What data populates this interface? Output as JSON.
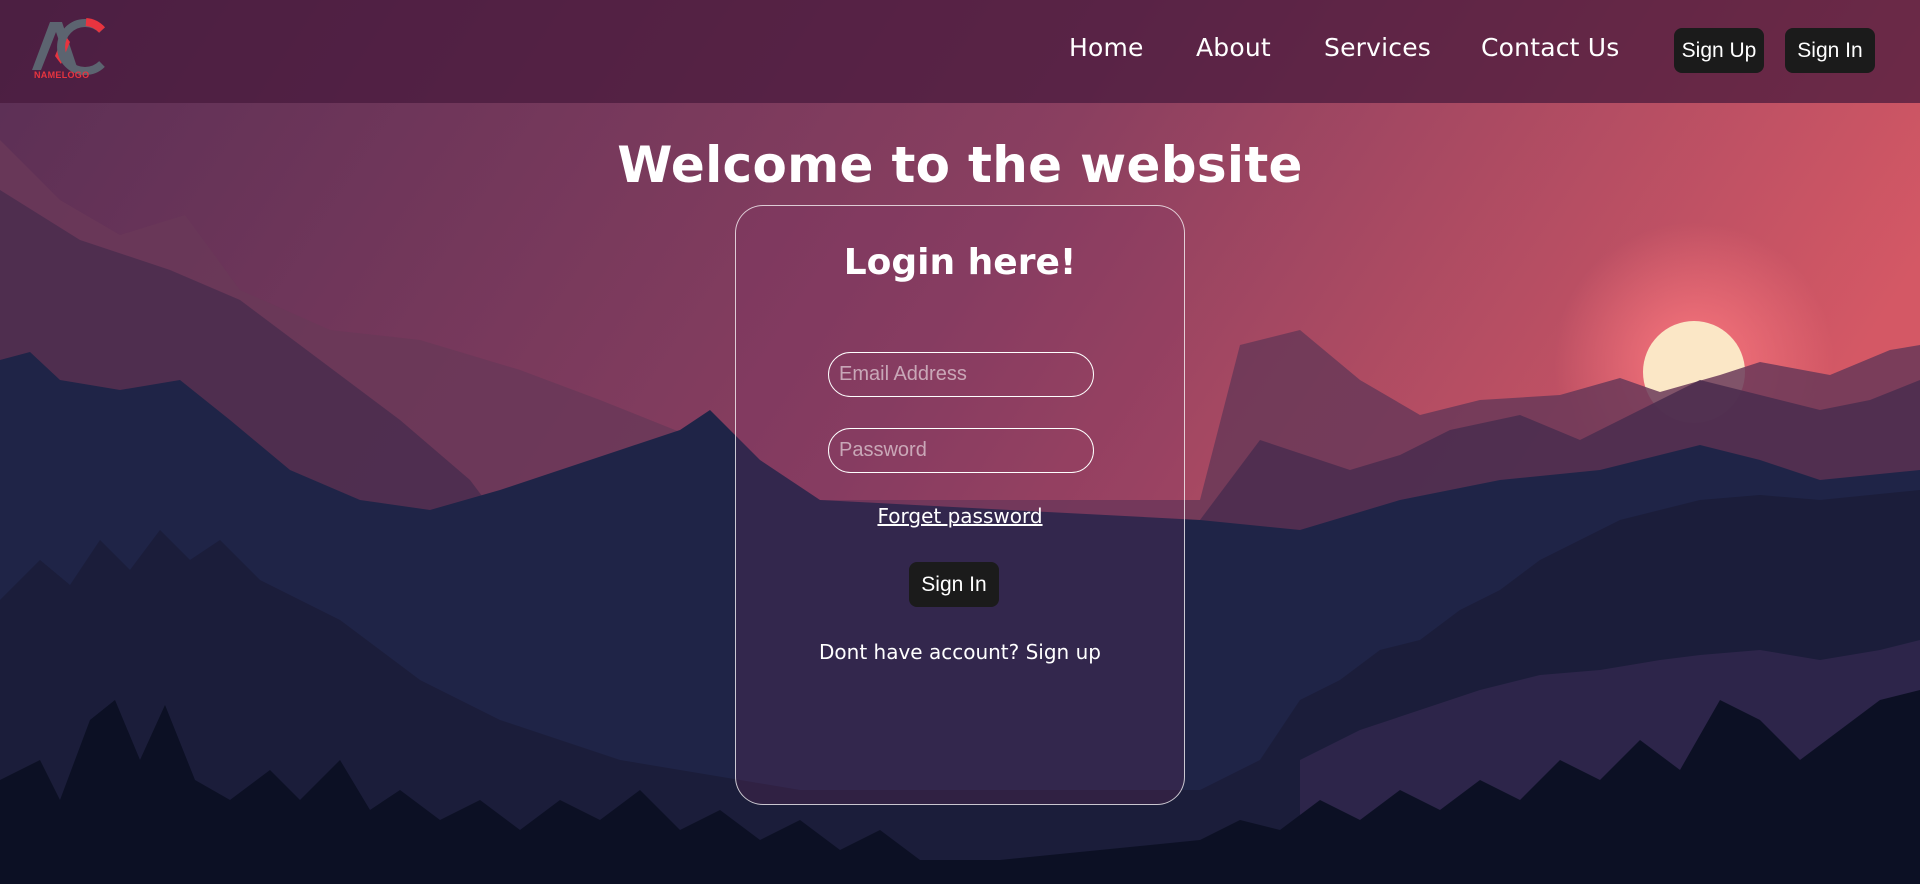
{
  "logo": {
    "letters": "AC",
    "caption": "NAMELOGO"
  },
  "nav": {
    "links": [
      "Home",
      "About",
      "Services",
      "Contact Us"
    ],
    "signup_button": "Sign Up",
    "signin_button": "Sign In"
  },
  "hero": {
    "title": "Welcome to the website"
  },
  "login": {
    "title": "Login here!",
    "email_placeholder": "Email Address",
    "password_placeholder": "Password",
    "forget_password": "Forget password",
    "signin_button": "Sign In",
    "no_account_text": "Dont have account?",
    "signup_link": "Sign up"
  },
  "colors": {
    "accent_red": "#e8343f",
    "button_dark": "#1b1b1b",
    "sky_top": "#4f2b52",
    "sky_horizon": "#c9546a",
    "sun": "#fbe7c6"
  }
}
